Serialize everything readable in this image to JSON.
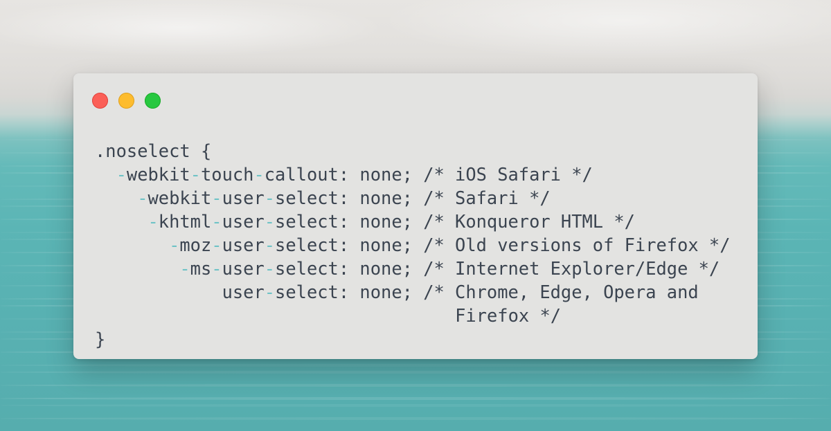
{
  "window": {
    "controls": {
      "close_color": "#fb5f57",
      "minimize_color": "#fdbc2e",
      "zoom_color": "#28c840"
    }
  },
  "code": {
    "lines": [
      ".noselect {",
      "  -webkit-touch-callout: none; /* iOS Safari */",
      "    -webkit-user-select: none; /* Safari */",
      "     -khtml-user-select: none; /* Konqueror HTML */",
      "       -moz-user-select: none; /* Old versions of Firefox */",
      "        -ms-user-select: none; /* Internet Explorer/Edge */",
      "            user-select: none; /* Chrome, Edge, Opera and",
      "                                  Firefox */",
      "}"
    ],
    "hyphen_color": "#6ec3c6",
    "text_color": "#3b4450"
  }
}
